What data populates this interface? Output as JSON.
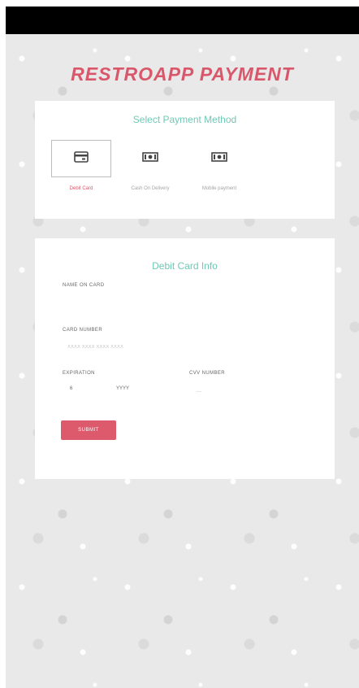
{
  "header": {
    "title": "RESTROAPP PAYMENT"
  },
  "payment": {
    "heading": "Select Payment Method",
    "methods": [
      {
        "label": "Debit Card",
        "icon": "credit-card-icon",
        "selected": true
      },
      {
        "label": "Cash On Delivery",
        "icon": "cash-icon",
        "selected": false
      },
      {
        "label": "Mobile payment",
        "icon": "cash-icon",
        "selected": false
      }
    ]
  },
  "debit": {
    "heading": "Debit Card Info",
    "name_label": "NAME ON CARD",
    "number_label": "CARD NUMBER",
    "number_placeholder": "XXXX XXXX XXXX XXXX",
    "expiration_label": "EXPIRATION",
    "exp_month": "6",
    "exp_year": "YYYY",
    "cvv_label": "CVV NUMBER",
    "cvv_placeholder": "—",
    "submit_label": "SUBMIT"
  },
  "colors": {
    "accent": "#d9576b",
    "heading": "#6fc9b4",
    "background": "#e9e9e9"
  }
}
